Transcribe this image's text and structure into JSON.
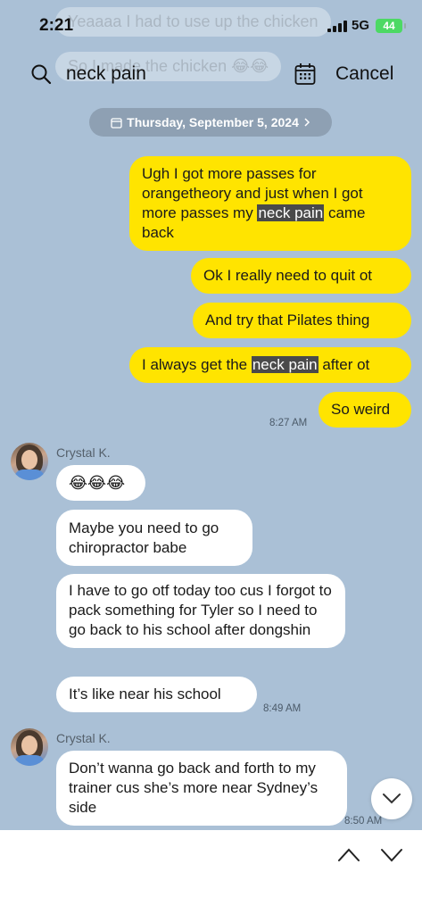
{
  "status": {
    "time": "2:21",
    "network": "5G",
    "battery": "44"
  },
  "search": {
    "query": "neck pain",
    "cancel_label": "Cancel"
  },
  "ghost": {
    "line1": "Yeaaaa I had to use up the chicken",
    "line2": "So I made the chicken 😂😂"
  },
  "date_divider": {
    "label": "Thursday, September 5, 2024"
  },
  "messages": {
    "out1_a": "Ugh I got more passes for orangetheory and just when I got more passes my ",
    "out1_hl": "neck pain",
    "out1_b": " came back",
    "out2": "Ok I really need to quit ot",
    "out3": "And try that Pilates thing",
    "out4_a": "I always get the ",
    "out4_hl": "neck pain",
    "out4_b": " after ot",
    "out5": "So weird",
    "out_time": "8:27 AM",
    "sender1": "Crystal K.",
    "in1": "😂😂😂",
    "in2": "Maybe you need to go chiropractor babe",
    "in3": "I have to go otf today too cus I forgot to pack something for Tyler so I need to go back to his school after dongshin",
    "in4": "It’s like near his school",
    "in_time1": "8:49 AM",
    "sender2": "Crystal K.",
    "in5": "Don’t wanna go back and forth to my trainer cus she’s more near Sydney’s side",
    "in_time2": "8:50 AM"
  },
  "colors": {
    "background": "#aac0d6",
    "outgoing": "#ffe400",
    "incoming": "#ffffff",
    "pill": "#8ea0b3",
    "battery": "#4cd964"
  }
}
